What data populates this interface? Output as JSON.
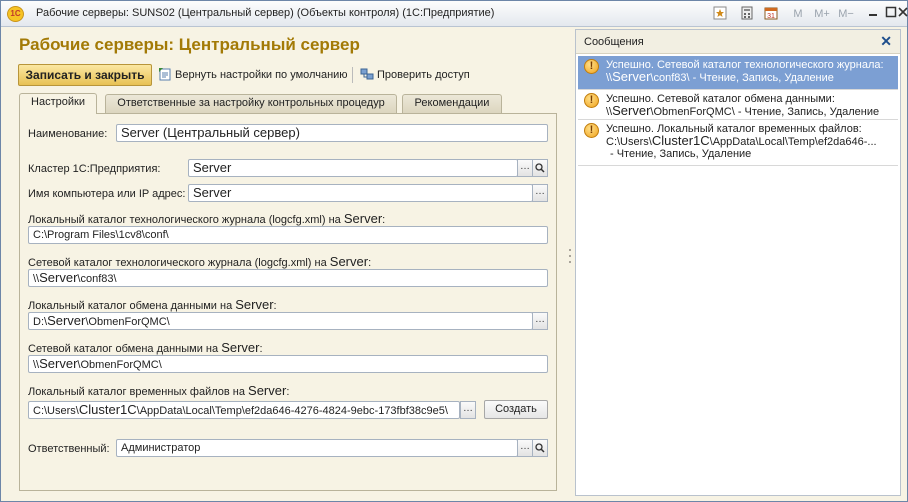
{
  "window": {
    "title": "Рабочие серверы: SUNS02 (Центральный сервер) (Объекты контроля)  (1С:Предприятие)",
    "app_logo": "1С",
    "toolbar_icons": [
      "favorite-icon",
      "calculator-icon",
      "calendar-icon"
    ],
    "memory_buttons": [
      "M",
      "M+",
      "M−"
    ],
    "window_controls": [
      "minimize-icon",
      "maximize-icon",
      "close-icon"
    ]
  },
  "form": {
    "title": "Рабочие серверы: Центральный сервер",
    "save_close_label": "Записать и закрыть",
    "restore_defaults_label": "Вернуть настройки по умолчанию",
    "check_access_label": "Проверить доступ"
  },
  "tabs": [
    {
      "label": "Настройки",
      "active": true
    },
    {
      "label": "Ответственные за настройку контрольных процедур",
      "active": false
    },
    {
      "label": "Рекомендации",
      "active": false
    }
  ],
  "fields": {
    "name_label": "Наименование:",
    "name_value": "Server (Центральный сервер)",
    "cluster_label": "Кластер 1С:Предприятия:",
    "cluster_value": "Server",
    "computer_label": "Имя компьютера или IP адрес:",
    "computer_value": "Server",
    "local_log_label": "Локальный каталог технологического журнала (logcfg.xml) на",
    "local_log_server": "Server",
    "local_log_value": "C:\\Program Files\\1cv8\\conf\\",
    "net_log_label": "Сетевой каталог технологического журнала (logcfg.xml) на",
    "net_log_server": "Server",
    "net_log_prefix": "\\\\",
    "net_log_server_in_path": "Server",
    "net_log_suffix": "\\conf83\\",
    "local_exchange_label": "Локальный каталог обмена данными на",
    "local_exchange_server": "Server",
    "local_exchange_prefix": "D:\\",
    "local_exchange_server_in_path": "Server",
    "local_exchange_suffix": "\\ObmenForQMC\\",
    "net_exchange_label": "Сетевой каталог обмена данными на",
    "net_exchange_server": "Server",
    "net_exchange_prefix": "\\\\",
    "net_exchange_server_in_path": "Server",
    "net_exchange_suffix": "\\ObmenForQMC\\",
    "temp_label": "Локальный каталог временных файлов на",
    "temp_server": "Server",
    "temp_prefix": "C:\\Users\\",
    "temp_cluster": "Cluster1C",
    "temp_suffix": "\\AppData\\Local\\Temp\\ef2da646-4276-4824-9ebc-173fbf38c9e5\\",
    "create_button": "Создать",
    "responsible_label": "Ответственный:",
    "responsible_value": "Администратор"
  },
  "messages": {
    "title": "Сообщения",
    "items": [
      {
        "line1": "Успешно. Сетевой каталог технологического журнала:",
        "prefix": "\\\\",
        "server": "Server",
        "rest": "\\conf83\\ - Чтение, Запись, Удаление",
        "selected": true
      },
      {
        "line1": "Успешно. Сетевой каталог обмена данными:",
        "prefix": "\\\\",
        "server": "Server",
        "rest": "\\ObmenForQMC\\ - Чтение, Запись, Удаление",
        "selected": false
      },
      {
        "line1": "Успешно. Локальный каталог временных файлов:",
        "prefix": "C:\\Users\\",
        "server": "Cluster1C",
        "rest": "\\AppData\\Local\\Temp\\ef2da646-...",
        "line3": "- Чтение, Запись, Удаление",
        "selected": false
      }
    ]
  },
  "colors": {
    "form_title": "#a37a06",
    "primary_button": "#e8c154",
    "selected_message": "#7c9fd3",
    "panel_background": "#f7f3e4"
  }
}
